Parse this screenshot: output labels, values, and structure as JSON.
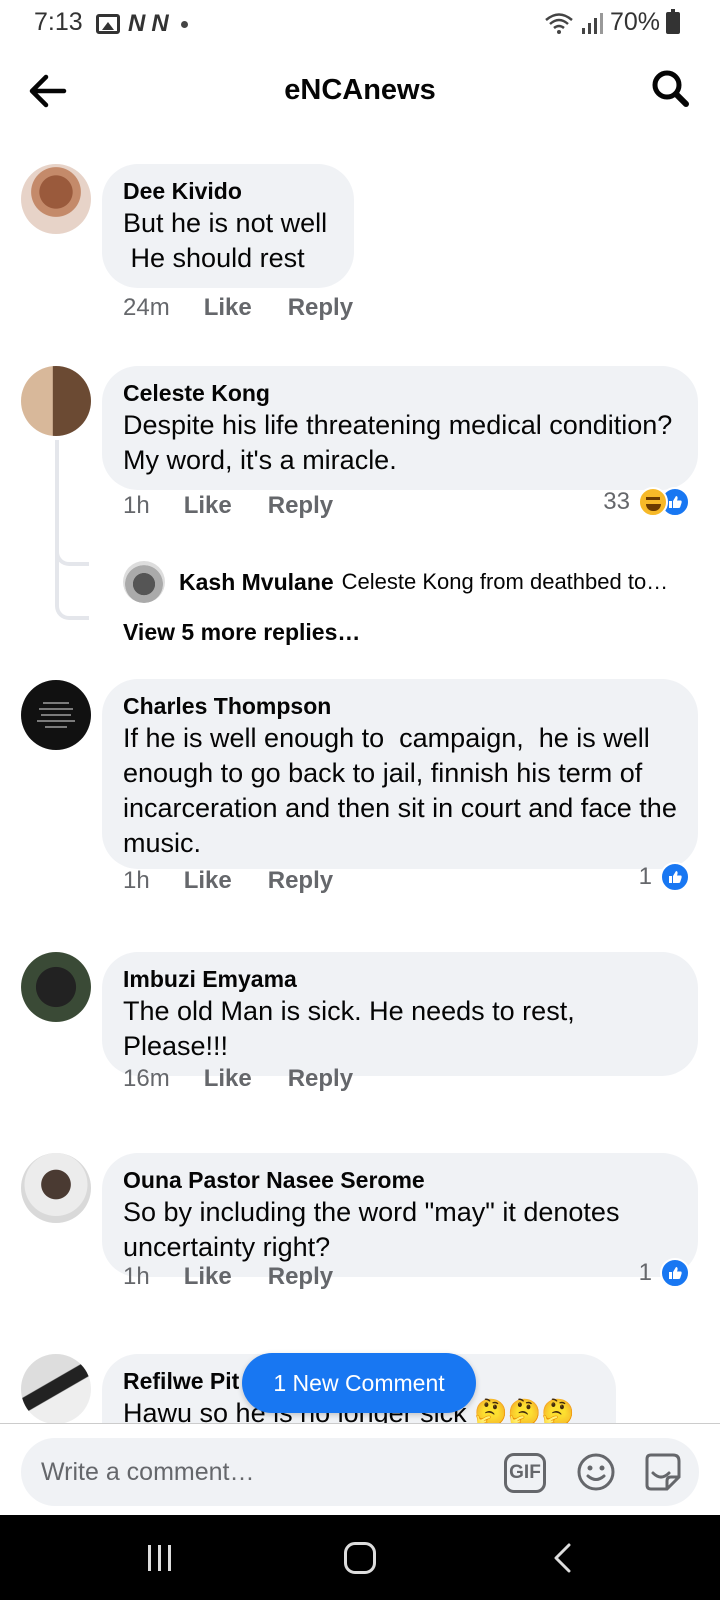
{
  "status_bar": {
    "time": "7:13",
    "battery": "70%"
  },
  "header": {
    "title": "eNCAnews"
  },
  "comments": [
    {
      "author": "Dee Kivido",
      "text": "But he is not well\n He should rest",
      "time": "24m",
      "like": "Like",
      "reply": "Reply"
    },
    {
      "author": "Celeste Kong",
      "text": "Despite his life threatening medical condition? My word, it's a miracle.",
      "time": "1h",
      "like": "Like",
      "reply": "Reply",
      "reaction_count": "33",
      "reactions": [
        "haha",
        "like"
      ],
      "latest_reply": {
        "author": "Kash Mvulane",
        "text": "Celeste Kong from deathbed to…"
      },
      "view_more": "View 5 more replies…"
    },
    {
      "author": "Charles Thompson",
      "text": "If he is well enough to  campaign,  he is well enough to go back to jail, finnish his term of incarceration and then sit in court and face the music.",
      "time": "1h",
      "like": "Like",
      "reply": "Reply",
      "reaction_count": "1",
      "reactions": [
        "like"
      ]
    },
    {
      "author": "Imbuzi Emyama",
      "text": "The old Man is sick. He needs to rest, Please!!!",
      "time": "16m",
      "like": "Like",
      "reply": "Reply"
    },
    {
      "author": "Ouna Pastor Nasee Serome",
      "text": "So by including the word \"may\" it denotes uncertainty right?",
      "time": "1h",
      "like": "Like",
      "reply": "Reply",
      "reaction_count": "1",
      "reactions": [
        "like"
      ]
    },
    {
      "author": "Refilwe Pit",
      "text": "Hawu so he is no longer sick 🤔🤔🤔"
    }
  ],
  "new_comment_pill": "1 New Comment",
  "composer": {
    "placeholder": "Write a comment…",
    "gif_label": "GIF"
  },
  "colors": {
    "accent": "#1877f2",
    "bubble": "#f0f2f5",
    "secondary_text": "#65676b"
  }
}
